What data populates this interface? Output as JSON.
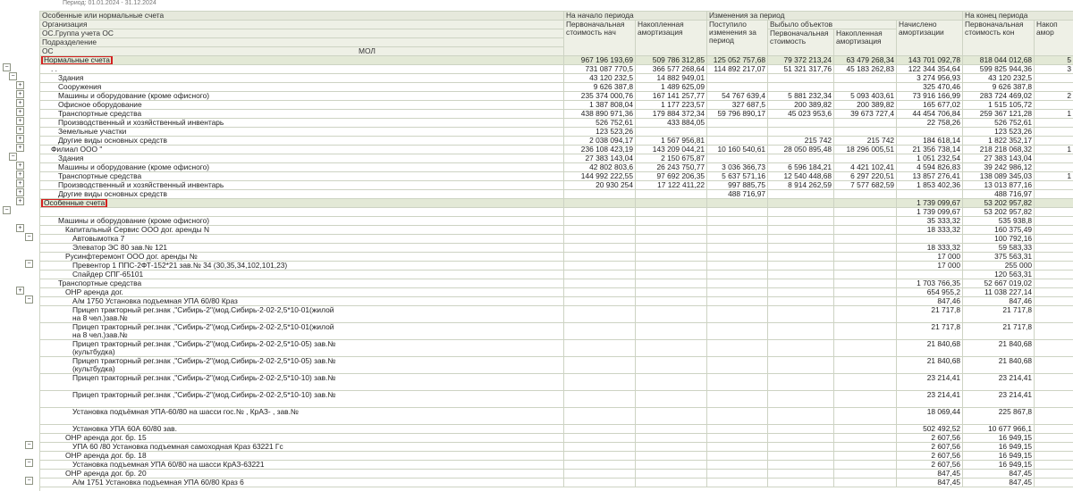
{
  "top_snippet": "Период: 01.01.2024 - 31.12.2024",
  "headers": {
    "row1_left": "Особенные или нормальные счета",
    "row2_left": "Организация",
    "row3_left": "ОС.Группа учета ОС",
    "row4_left": "Подразделение",
    "row5_left_a": "ОС",
    "row5_left_b": "МОЛ",
    "g1": "На начало периода",
    "g2": "Изменения за период",
    "g2b": "Выбыло объектов",
    "g3": "На конец периода",
    "c1": "Первоначальная стоимость нач",
    "c2": "Накопленная амортизация",
    "c3": "Поступило изменения за период",
    "c4": "Первоначальная стоимость",
    "c5": "Накопленная амортизация",
    "c6": "Начислено амортизации",
    "c7": "Первоначальная стоимость кон",
    "c8": "Накоп амор"
  },
  "rows": [
    {
      "label": "Нормальные счета",
      "lvl": 0,
      "cls": "tot",
      "box": true,
      "v": [
        "967 196 193,69",
        "509 786 312,85",
        "125 052 757,68",
        "79 372 213,24",
        "63 479 268,34",
        "143 701 092,78",
        "818 044 012,68",
        "5"
      ]
    },
    {
      "label": ". .",
      "lvl": 1,
      "cls": "",
      "v": [
        "731 087 770,5",
        "366 577 268,64",
        "114 892 217,07",
        "51 321 317,76",
        "45 183 262,83",
        "122 344 354,64",
        "599 825 944,36",
        "3"
      ]
    },
    {
      "label": "Здания",
      "lvl": 2,
      "cls": "",
      "v": [
        "43 120 232,5",
        "14 882 949,01",
        "",
        "",
        "",
        "3 274 956,93",
        "43 120 232,5",
        ""
      ]
    },
    {
      "label": "Сооружения",
      "lvl": 2,
      "cls": "",
      "v": [
        "9 626 387,8",
        "1 489 625,09",
        "",
        "",
        "",
        "325 470,46",
        "9 626 387,8",
        ""
      ]
    },
    {
      "label": "Машины и оборудование (кроме офисного)",
      "lvl": 2,
      "cls": "",
      "v": [
        "235 374 000,76",
        "167 141 257,77",
        "54 767 639,4",
        "5 881 232,34",
        "5 093 403,61",
        "73 916 166,99",
        "283 724 469,02",
        "2"
      ]
    },
    {
      "label": "Офисное оборудование",
      "lvl": 2,
      "cls": "",
      "v": [
        "1 387 808,04",
        "1 177 223,57",
        "327 687,5",
        "200 389,82",
        "200 389,82",
        "165 677,02",
        "1 515 105,72",
        ""
      ]
    },
    {
      "label": "Транспортные средства",
      "lvl": 2,
      "cls": "",
      "v": [
        "438 890 971,36",
        "179 884 372,34",
        "59 796 890,17",
        "45 023 953,6",
        "39 673 727,4",
        "44 454 706,84",
        "259 367 121,28",
        "1"
      ]
    },
    {
      "label": "Производственный и хозяйственный инвентарь",
      "lvl": 2,
      "cls": "",
      "v": [
        "526 752,61",
        "433 884,05",
        "",
        "",
        "",
        "22 758,26",
        "526 752,61",
        ""
      ]
    },
    {
      "label": "Земельные участки",
      "lvl": 2,
      "cls": "",
      "v": [
        "123 523,26",
        "",
        "",
        "",
        "",
        "",
        "123 523,26",
        ""
      ]
    },
    {
      "label": "Другие виды основных средств",
      "lvl": 2,
      "cls": "",
      "v": [
        "2 038 094,17",
        "1 567 956,81",
        "",
        "215 742",
        "215 742",
        "184 618,14",
        "1 822 352,17",
        ""
      ]
    },
    {
      "label": "Филиал ООО \"",
      "lvl": 1,
      "cls": "",
      "v": [
        "236 108 423,19",
        "143 209 044,21",
        "10 160 540,61",
        "28 050 895,48",
        "18 296 005,51",
        "21 356 738,14",
        "218 218 068,32",
        "1"
      ]
    },
    {
      "label": "Здания",
      "lvl": 2,
      "cls": "",
      "v": [
        "27 383 143,04",
        "2 150 675,87",
        "",
        "",
        "",
        "1 051 232,54",
        "27 383 143,04",
        ""
      ]
    },
    {
      "label": "Машины и оборудование (кроме офисного)",
      "lvl": 2,
      "cls": "",
      "v": [
        "42 802 803,6",
        "26 243 750,77",
        "3 036 366,73",
        "6 596 184,21",
        "4 421 102,41",
        "4 594 826,83",
        "39 242 986,12",
        ""
      ]
    },
    {
      "label": "Транспортные средства",
      "lvl": 2,
      "cls": "",
      "v": [
        "144 992 222,55",
        "97 692 206,35",
        "5 637 571,16",
        "12 540 448,68",
        "6 297 220,51",
        "13 857 276,41",
        "138 089 345,03",
        "1"
      ]
    },
    {
      "label": "Производственный и хозяйственный инвентарь",
      "lvl": 2,
      "cls": "",
      "v": [
        "20 930 254",
        "17 122 411,22",
        "997 885,75",
        "8 914 262,59",
        "7 577 682,59",
        "1 853 402,36",
        "13 013 877,16",
        ""
      ]
    },
    {
      "label": "Другие виды основных средств",
      "lvl": 2,
      "cls": "",
      "v": [
        "",
        "",
        "488 716,97",
        "",
        "",
        "",
        "488 716,97",
        ""
      ]
    },
    {
      "label": "Особенные счета",
      "lvl": 0,
      "cls": "tot",
      "box": true,
      "v": [
        "",
        "",
        "",
        "",
        "",
        "1 739 099,67",
        "53 202 957,82",
        ""
      ]
    },
    {
      "label": "",
      "lvl": 1,
      "cls": "",
      "v": [
        "",
        "",
        "",
        "",
        "",
        "1 739 099,67",
        "53 202 957,82",
        ""
      ]
    },
    {
      "label": "Машины и оборудование (кроме офисного)",
      "lvl": 2,
      "cls": "",
      "v": [
        "",
        "",
        "",
        "",
        "",
        "35 333,32",
        "535 938,8",
        ""
      ]
    },
    {
      "label": "Капитальный Сервис ООО дог. аренды N",
      "lvl": 3,
      "cls": "",
      "v": [
        "",
        "",
        "",
        "",
        "",
        "18 333,32",
        "160 375,49",
        ""
      ]
    },
    {
      "label": "Автовымотка 7",
      "lvl": 4,
      "cls": "",
      "v": [
        "",
        "",
        "",
        "",
        "",
        "",
        "100 792,16",
        ""
      ]
    },
    {
      "label": "Элеватор ЭС 80 зав.№ 121",
      "lvl": 4,
      "cls": "",
      "v": [
        "",
        "",
        "",
        "",
        "",
        "18 333,32",
        "59 583,33",
        ""
      ]
    },
    {
      "label": "Русинфтеремонт ООО дог. аренды №",
      "lvl": 3,
      "cls": "",
      "v": [
        "",
        "",
        "",
        "",
        "",
        "17 000",
        "375 563,31",
        ""
      ]
    },
    {
      "label": "Превентор 1 ППС-2ФТ-152*21 зав.№ 34  (30,35,34,102,101,23)",
      "lvl": 4,
      "cls": "",
      "v": [
        "",
        "",
        "",
        "",
        "",
        "17 000",
        "255 000",
        ""
      ]
    },
    {
      "label": "Спайдер СПГ-65101",
      "lvl": 4,
      "cls": "",
      "v": [
        "",
        "",
        "",
        "",
        "",
        "",
        "120 563,31",
        ""
      ]
    },
    {
      "label": "Транспортные средства",
      "lvl": 2,
      "cls": "",
      "v": [
        "",
        "",
        "",
        "",
        "",
        "1 703 766,35",
        "52 667 019,02",
        ""
      ]
    },
    {
      "label": "ОНР аренда дог.",
      "lvl": 3,
      "cls": "",
      "v": [
        "",
        "",
        "",
        "",
        "",
        "654 955,2",
        "11 038 227,14",
        ""
      ]
    },
    {
      "label": "А/м 1750 Установка подъемная УПА 60/80 Краз",
      "lvl": 4,
      "cls": "",
      "v": [
        "",
        "",
        "",
        "",
        "",
        "847,46",
        "847,46",
        ""
      ]
    },
    {
      "label": "Прицеп тракторный рег.знак ,\"Сибирь-2\"(мод.Сибирь-2-02-2,5*10-01(жилой на 8 чел.)зав.№",
      "lvl": 4,
      "cls": "wrap2",
      "v": [
        "",
        "",
        "",
        "",
        "",
        "21 717,8",
        "21 717,8",
        ""
      ]
    },
    {
      "label": "Прицеп тракторный рег.знак ,\"Сибирь-2\"(мод.Сибирь-2-02-2,5*10-01(жилой на 8 чел.)зав.№",
      "lvl": 4,
      "cls": "wrap2",
      "v": [
        "",
        "",
        "",
        "",
        "",
        "21 717,8",
        "21 717,8",
        ""
      ]
    },
    {
      "label": "Прицеп тракторный рег.знак ,\"Сибирь-2\"(мод.Сибирь-2-02-2,5*10-05) зав.№ (культбудка)",
      "lvl": 4,
      "cls": "wrap2",
      "v": [
        "",
        "",
        "",
        "",
        "",
        "21 840,68",
        "21 840,68",
        ""
      ]
    },
    {
      "label": "Прицеп тракторный рег.знак ,\"Сибирь-2\"(мод.Сибирь-2-02-2,5*10-05) зав.№ (культбудка)",
      "lvl": 4,
      "cls": "wrap2",
      "v": [
        "",
        "",
        "",
        "",
        "",
        "21 840,68",
        "21 840,68",
        ""
      ]
    },
    {
      "label": "Прицеп тракторный рег.знак ,\"Сибирь-2\"(мод.Сибирь-2-02-2,5*10-10) зав.№",
      "lvl": 4,
      "cls": "wrap2",
      "v": [
        "",
        "",
        "",
        "",
        "",
        "23 214,41",
        "23 214,41",
        ""
      ]
    },
    {
      "label": "Прицеп тракторный рег.знак ,\"Сибирь-2\"(мод.Сибирь-2-02-2,5*10-10) зав.№",
      "lvl": 4,
      "cls": "wrap2",
      "v": [
        "",
        "",
        "",
        "",
        "",
        "23 214,41",
        "23 214,41",
        ""
      ]
    },
    {
      "label": "Установка подъёмная УПА-60/80 на шасси гос.№ , КрАЗ- , зав.№",
      "lvl": 4,
      "cls": "wrap2",
      "v": [
        "",
        "",
        "",
        "",
        "",
        "18 069,44",
        "225 867,8",
        ""
      ]
    },
    {
      "label": "Установка УПА 60А 60/80 зав.",
      "lvl": 4,
      "cls": "",
      "v": [
        "",
        "",
        "",
        "",
        "",
        "502 492,52",
        "10 677 966,1",
        ""
      ]
    },
    {
      "label": "ОНР аренда дог. бр. 15",
      "lvl": 3,
      "cls": "",
      "v": [
        "",
        "",
        "",
        "",
        "",
        "2 607,56",
        "16 949,15",
        ""
      ]
    },
    {
      "label": "УПА 60 /80 Установка подъемная самоходная Краз 63221 Гс",
      "lvl": 4,
      "cls": "",
      "v": [
        "",
        "",
        "",
        "",
        "",
        "2 607,56",
        "16 949,15",
        ""
      ]
    },
    {
      "label": "ОНР аренда дог. бр. 18",
      "lvl": 3,
      "cls": "",
      "v": [
        "",
        "",
        "",
        "",
        "",
        "2 607,56",
        "16 949,15",
        ""
      ]
    },
    {
      "label": "Установка подъемная УПА 60/80 на шасси КрАЗ-63221",
      "lvl": 4,
      "cls": "",
      "v": [
        "",
        "",
        "",
        "",
        "",
        "2 607,56",
        "16 949,15",
        ""
      ]
    },
    {
      "label": "ОНР аренда дог. бр. 20",
      "lvl": 3,
      "cls": "",
      "v": [
        "",
        "",
        "",
        "",
        "",
        "847,45",
        "847,45",
        ""
      ]
    },
    {
      "label": "А/м 1751 Установка подъемная УПА 60/80 Краз 6",
      "lvl": 4,
      "cls": "",
      "v": [
        "",
        "",
        "",
        "",
        "",
        "847,45",
        "847,45",
        ""
      ]
    }
  ]
}
